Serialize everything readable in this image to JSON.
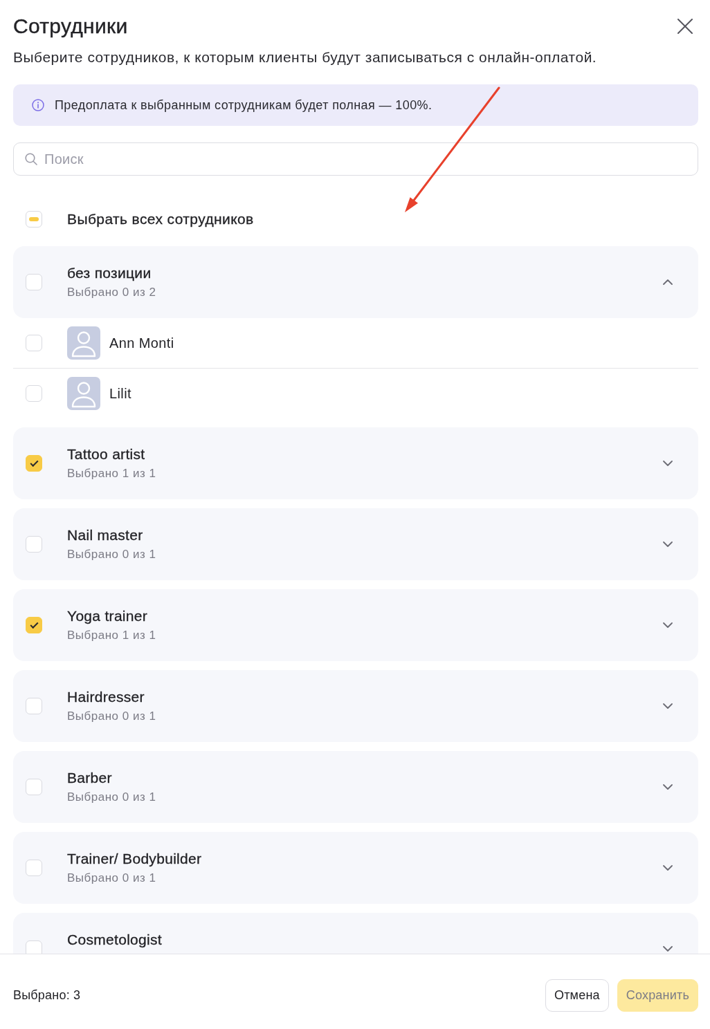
{
  "dialog": {
    "title": "Сотрудники",
    "subtitle": "Выберите сотрудников, к которым клиенты будут записываться с онлайн-оплатой."
  },
  "info_banner": {
    "text": "Предоплата к выбранным сотрудникам будет полная — 100%."
  },
  "search": {
    "placeholder": "Поиск"
  },
  "select_all": {
    "label": "Выбрать всех сотрудников",
    "partial": true
  },
  "groups": [
    {
      "title": "без позиции",
      "subtitle": "Выбрано 0 из 2",
      "checked": false,
      "expanded": true,
      "employees": [
        {
          "name": "Ann Monti",
          "checked": false
        },
        {
          "name": "Lilit",
          "checked": false
        }
      ]
    },
    {
      "title": "Tattoo artist",
      "subtitle": "Выбрано 1 из 1",
      "checked": true,
      "expanded": false
    },
    {
      "title": "Nail master",
      "subtitle": "Выбрано 0 из 1",
      "checked": false,
      "expanded": false
    },
    {
      "title": "Yoga trainer",
      "subtitle": "Выбрано 1 из 1",
      "checked": true,
      "expanded": false
    },
    {
      "title": "Hairdresser",
      "subtitle": "Выбрано 0 из 1",
      "checked": false,
      "expanded": false
    },
    {
      "title": "Barber",
      "subtitle": "Выбрано 0 из 1",
      "checked": false,
      "expanded": false
    },
    {
      "title": "Trainer/ Bodybuilder",
      "subtitle": "Выбрано 0 из 1",
      "checked": false,
      "expanded": false
    },
    {
      "title": "Cosmetologist",
      "checked": false,
      "expanded": false
    }
  ],
  "footer": {
    "selected_count": "Выбрано: 3",
    "buttons": [
      {
        "label": "Отмена",
        "kind": "secondary",
        "disabled": false
      },
      {
        "label": "Сохранить",
        "kind": "primary",
        "disabled": true
      }
    ]
  }
}
